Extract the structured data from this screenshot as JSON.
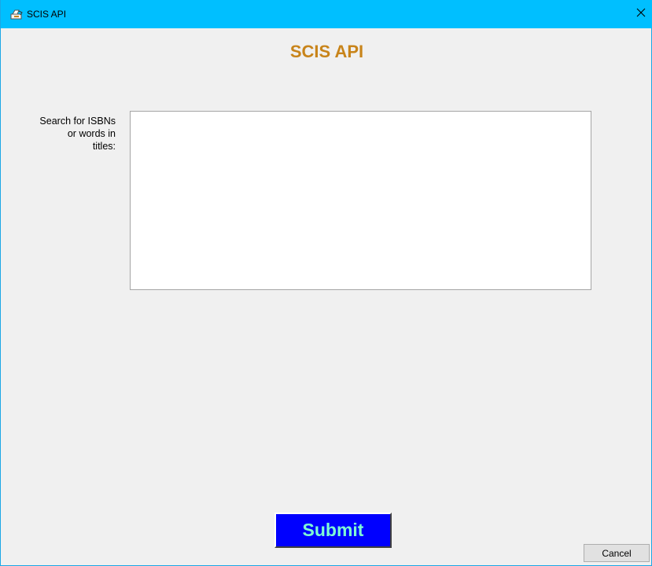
{
  "window": {
    "title": "SCIS API",
    "icon": "app-icon",
    "close_icon": "close-icon",
    "titlebar_color": "#00bfff"
  },
  "main": {
    "heading": "SCIS API",
    "heading_color": "#c8841a",
    "search": {
      "label_line1": "Search for ISBNs",
      "label_line2": "or words in",
      "label_line3": "titles:",
      "value": "",
      "placeholder": ""
    }
  },
  "actions": {
    "submit_label": "Submit",
    "submit_bg": "#0000ff",
    "submit_text_color": "#7fffd4",
    "cancel_label": "Cancel"
  }
}
